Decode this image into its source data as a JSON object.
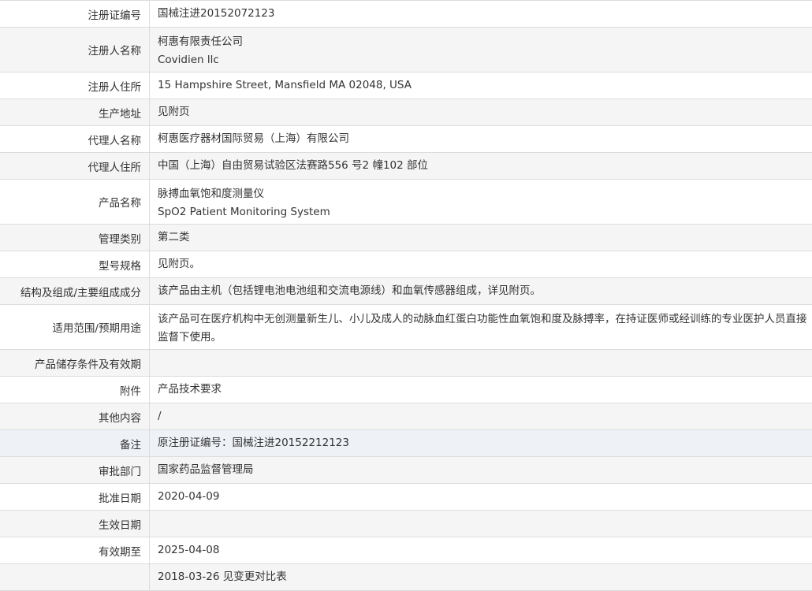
{
  "rows": [
    {
      "label": "注册证编号",
      "values": [
        "国械注进20152072123"
      ]
    },
    {
      "label": "注册人名称",
      "values": [
        "柯惠有限责任公司",
        "Covidien llc"
      ]
    },
    {
      "label": "注册人住所",
      "values": [
        "15 Hampshire Street, Mansfield MA 02048, USA"
      ]
    },
    {
      "label": "生产地址",
      "values": [
        "见附页"
      ]
    },
    {
      "label": "代理人名称",
      "values": [
        "柯惠医疗器材国际贸易（上海）有限公司"
      ]
    },
    {
      "label": "代理人住所",
      "values": [
        "中国（上海）自由贸易试验区法赛路556 号2 幢102 部位"
      ]
    },
    {
      "label": "产品名称",
      "values": [
        "脉搏血氧饱和度测量仪",
        "SpO2 Patient Monitoring System"
      ]
    },
    {
      "label": "管理类别",
      "values": [
        "第二类"
      ]
    },
    {
      "label": "型号规格",
      "values": [
        "见附页。"
      ]
    },
    {
      "label": "结构及组成/主要组成成分",
      "values": [
        "该产品由主机（包括锂电池电池组和交流电源线）和血氧传感器组成，详见附页。"
      ]
    },
    {
      "label": "适用范围/预期用途",
      "values": [
        "该产品可在医疗机构中无创测量新生儿、小儿及成人的动脉血红蛋白功能性血氧饱和度及脉搏率，在持证医师或经训练的专业医护人员直接监督下使用。"
      ]
    },
    {
      "label": "产品储存条件及有效期",
      "values": [
        ""
      ]
    },
    {
      "label": "附件",
      "values": [
        "产品技术要求"
      ]
    },
    {
      "label": "其他内容",
      "values": [
        "/"
      ]
    },
    {
      "label": "备注",
      "values": [
        "原注册证编号：国械注进20152212123"
      ]
    },
    {
      "label": "审批部门",
      "values": [
        "国家药品监督管理局"
      ]
    },
    {
      "label": "批准日期",
      "values": [
        "2020-04-09"
      ]
    },
    {
      "label": "生效日期",
      "values": [
        ""
      ]
    },
    {
      "label": "有效期至",
      "values": [
        "2025-04-08"
      ]
    },
    {
      "label": "",
      "values": [
        "2018-03-26 见变更对比表"
      ]
    }
  ]
}
